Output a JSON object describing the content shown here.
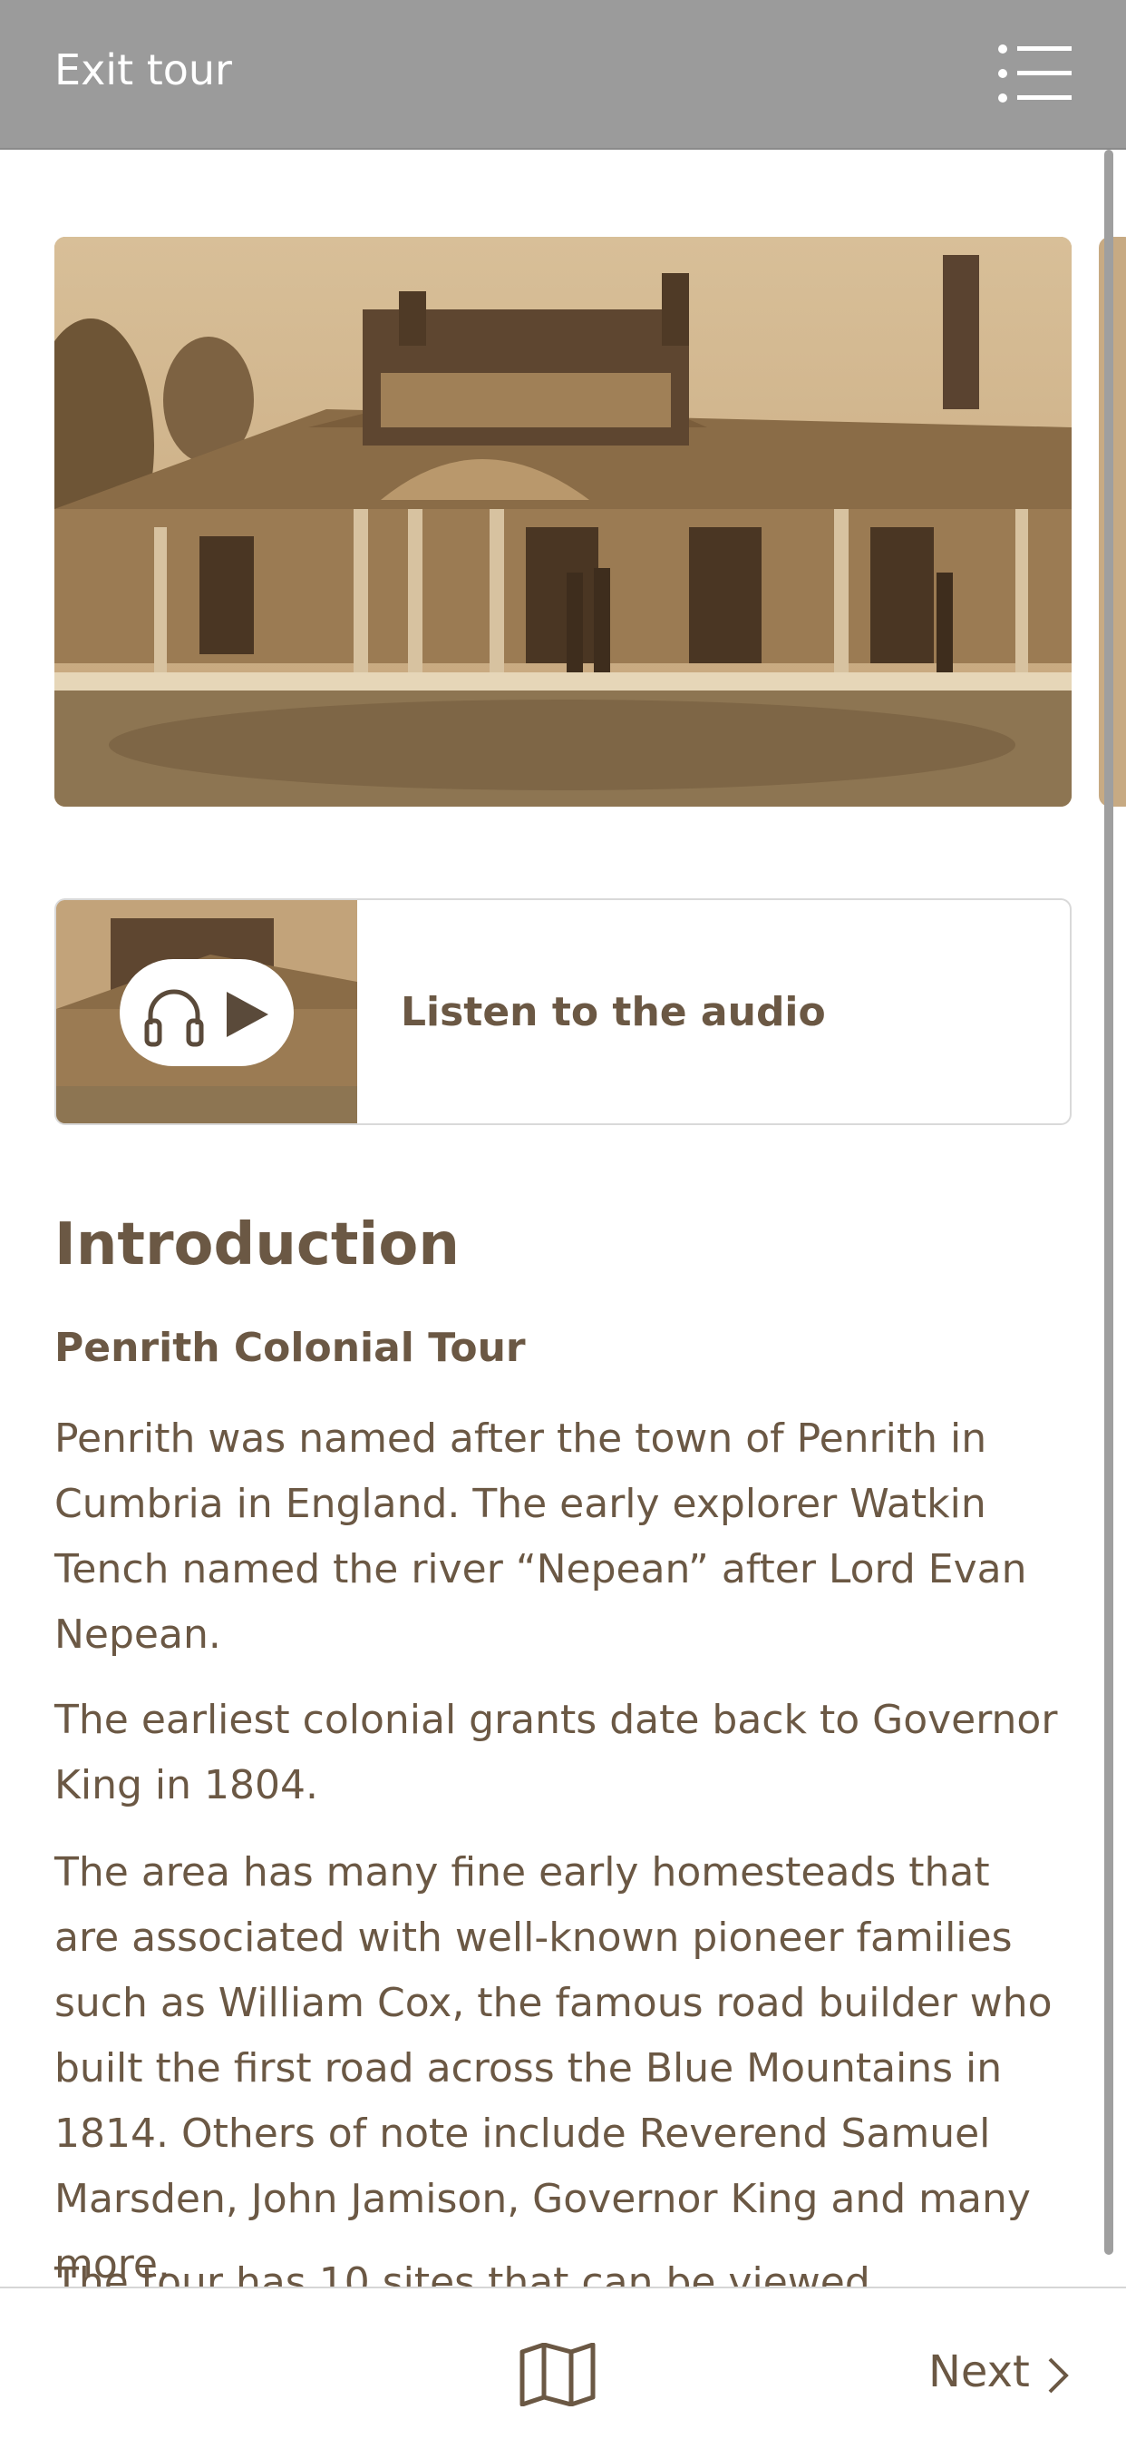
{
  "header": {
    "exit_label": "Exit tour",
    "menu_icon": "list-menu-icon",
    "background": "#9b9b9b"
  },
  "carousel": {
    "image_desc": "sepia-historic-homestead-photo"
  },
  "audio": {
    "label": "Listen to the audio",
    "icons": [
      "headphones-icon",
      "play-icon"
    ]
  },
  "article": {
    "heading": "Introduction",
    "subheading": "Penrith Colonial Tour",
    "paragraphs": [
      "Penrith was named after the town of Penrith in Cumbria in England. The early explorer Watkin Tench named the river “Nepean” after Lord Evan Nepean.",
      "The earliest colonial grants date back to Governor King in 1804.",
      "The area has many fine early homesteads that are associated with well-known pioneer families such as William Cox, the famous road builder who built the first road across the Blue Mountains in 1814. Others of note include Reverend Samuel Marsden, John Jamison, Governor King and many more.",
      "The tour has 10 sites that can be viewed"
    ]
  },
  "footer": {
    "map_icon": "map-icon",
    "next_label": "Next",
    "next_icon": "chevron-right-icon"
  },
  "colors": {
    "text": "#6b5844",
    "header": "#9b9b9b",
    "sepia": "#b8976d"
  }
}
